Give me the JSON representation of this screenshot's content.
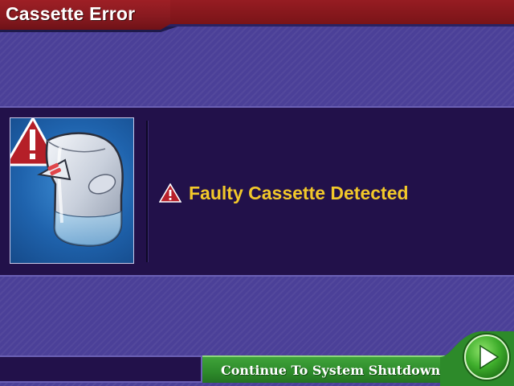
{
  "window": {
    "title": "Cassette Error"
  },
  "panel": {
    "illustration_icon": "cassette-warning-illustration",
    "message_icon": "warning-triangle-icon",
    "message": "Faulty Cassette Detected"
  },
  "footer": {
    "continue_label": "Continue To System Shutdown",
    "go_icon": "play-arrow-icon"
  },
  "colors": {
    "title_bar": "#881a20",
    "panel_background": "#22114a",
    "page_background": "#4b4098",
    "message_text": "#f2c82a",
    "continue_bar": "#2d8a2a"
  }
}
